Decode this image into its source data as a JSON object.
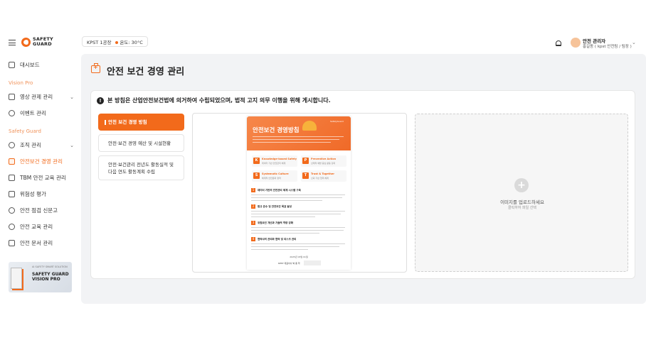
{
  "sidebar": {
    "logo": {
      "line1": "SAFETY",
      "line2": "GUARD"
    },
    "sections": {
      "vision": "Vision Pro",
      "safety": "Safety Guard"
    },
    "items": [
      {
        "label": "대시보드",
        "icon": "dashboard-icon"
      },
      {
        "label": "영상 관제 관리",
        "icon": "monitor-icon",
        "expandable": true
      },
      {
        "label": "이벤트 관리",
        "icon": "event-icon"
      },
      {
        "label": "조직 관리",
        "icon": "organization-icon",
        "expandable": true
      },
      {
        "label": "안전보건 경영 관리",
        "icon": "first-aid-kit-icon",
        "active": true
      },
      {
        "label": "TBM 안전 교육 관리",
        "icon": "meeting-icon"
      },
      {
        "label": "위험성 평가",
        "icon": "warning-icon"
      },
      {
        "label": "안전 점검 신문고",
        "icon": "shield-icon"
      },
      {
        "label": "안전 교육 관리",
        "icon": "shield-check-icon"
      },
      {
        "label": "안전 문서 관리",
        "icon": "document-icon"
      }
    ],
    "promo": {
      "subtitle": "AI SAFETY SMART SOLUTION",
      "title1": "SAFETY GUARD",
      "title2": "VISION PRO"
    }
  },
  "topbar": {
    "site": "KPST 1공장",
    "temperature": "온도: 30°C",
    "user_name": "안전 관리자",
    "user_org": "홍길동 ( kpst 안전팀 / 팀장 )"
  },
  "page": {
    "title": "안전 보건 경영 관리",
    "notice": "본 방침은 산업안전보건법에 의거하여 수립되었으며, 법적 고지 의무 이행을 위해 게시합니다."
  },
  "tabs": [
    {
      "label": "안전 보건 경영 방침",
      "active": true
    },
    {
      "label": "안전·보건 경영 예산 및 시설현황",
      "active": false
    },
    {
      "label_line1": "안전·보건관리 전년도 활동실적 및",
      "label_line2": "다음 연도 활동계획 수립",
      "active": false
    }
  ],
  "document": {
    "title": "안전보건 경영방침",
    "brand": "SafetyGuard",
    "pillars": [
      {
        "key": "K",
        "title": "Knowledge-based Safety",
        "sub": "데이터 기반 안전관리 체계"
      },
      {
        "key": "P",
        "title": "Preventive Action",
        "sub": "선제적 예방 중심 활동 강화"
      },
      {
        "key": "S",
        "title": "Systematic Culture",
        "sub": "체계적 안전문화 정착"
      },
      {
        "key": "T",
        "title": "Trust & Together",
        "sub": "신뢰 기반 협력 체계"
      }
    ],
    "sections": [
      {
        "n": "1",
        "title": "데이터 기반의 안전관리 체계 시스템 구축"
      },
      {
        "n": "2",
        "title": "법규 준수 및 안전보건 목표 달성"
      },
      {
        "n": "3",
        "title": "위험요인 개선과 기술적 역량 강화"
      },
      {
        "n": "4",
        "title": "협력사의 관리와 협력 및 리스크 관리"
      }
    ],
    "date": "2025년 03월 01일",
    "signature": "KPST 대표이사   박 종 학"
  },
  "upload": {
    "title": "이미지를 업로드하세요",
    "subtitle": "클릭하여 파일 선택"
  }
}
